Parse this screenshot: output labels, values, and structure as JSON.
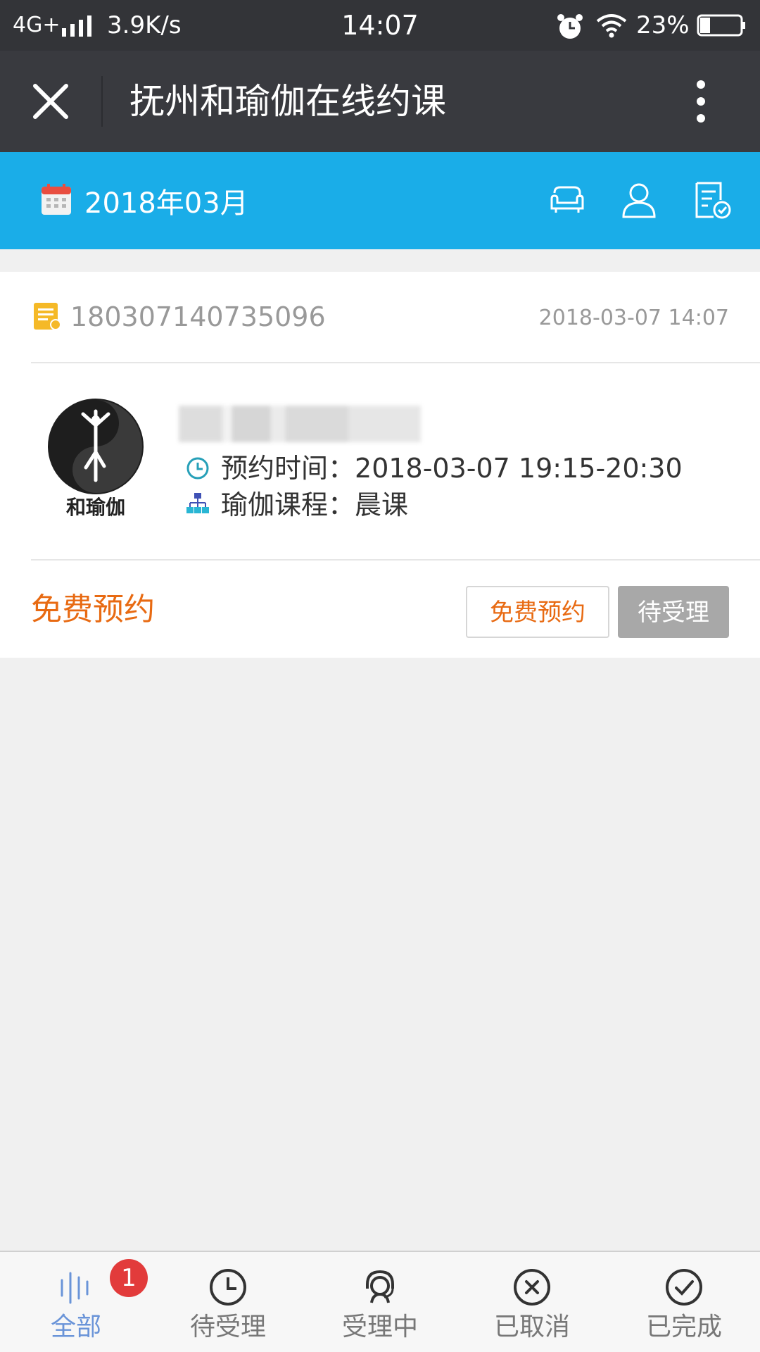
{
  "status_bar": {
    "network": "4G+",
    "speed": "3.9K/s",
    "time": "14:07",
    "battery": "23%",
    "icons": [
      "signal-icon",
      "alarm-icon",
      "wifi-icon",
      "battery-icon"
    ]
  },
  "navbar": {
    "title": "抚州和瑜伽在线约课",
    "close_icon": "close-icon",
    "more_icon": "more-vertical-icon"
  },
  "header": {
    "month": "2018年03月",
    "accent_color": "#1aade8",
    "icons": [
      "calendar-icon",
      "sofa-icon",
      "user-icon",
      "order-list-icon"
    ]
  },
  "order": {
    "number": "180307140735096",
    "created_at": "2018-03-07 14:07",
    "logo_text": "和瑜伽",
    "time_label": "预约时间：",
    "time_value": "2018-03-07 19:15-20:30",
    "course_label": "瑜伽课程：",
    "course_value": "晨课",
    "type_label": "免费预约",
    "buttons": {
      "free": "免费预约",
      "pending": "待受理"
    }
  },
  "tabs": [
    {
      "label": "全部",
      "icon": "all-icon",
      "active": true,
      "badge": "1"
    },
    {
      "label": "待受理",
      "icon": "clock-icon",
      "active": false
    },
    {
      "label": "受理中",
      "icon": "support-agent-icon",
      "active": false
    },
    {
      "label": "已取消",
      "icon": "cancel-circle-icon",
      "active": false
    },
    {
      "label": "已完成",
      "icon": "check-circle-icon",
      "active": false
    }
  ]
}
